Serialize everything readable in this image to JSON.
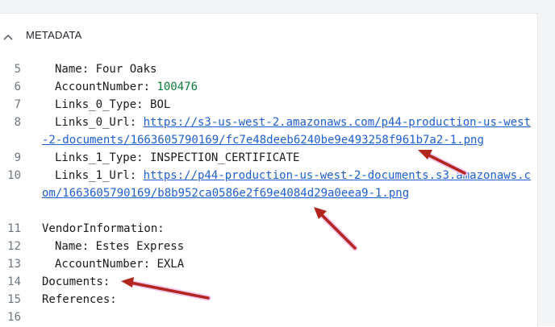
{
  "panel": {
    "title": "METADATA"
  },
  "lines": [
    {
      "n": "5",
      "key": "Name: ",
      "val": "Four Oaks"
    },
    {
      "n": "6",
      "key": "AccountNumber: ",
      "val": "100476"
    },
    {
      "n": "7",
      "key": "Links_0_Type: ",
      "val": "BOL"
    },
    {
      "n": "8",
      "key": "Links_0_Url: ",
      "link": "https://s3-us-west-2.amazonaws.com/p44-production-us-west-2-documents/1663605790169/fc7e48deeb6240be9e493258f961b7a2-1.png"
    },
    {
      "n": "9",
      "key": "Links_1_Type: ",
      "val": "INSPECTION_CERTIFICATE"
    },
    {
      "n": "10",
      "key": "Links_1_Url: ",
      "link": "https://p44-production-us-west-2-documents.s3.amazonaws.com/1663605790169/b8b952ca0586e2f69e4084d29a0eea9-1.png"
    },
    {
      "n": "11",
      "key": "VendorInformation:"
    },
    {
      "n": "12",
      "key": "Name: ",
      "val": "Estes Express"
    },
    {
      "n": "13",
      "key": "AccountNumber: ",
      "val": "EXLA"
    },
    {
      "n": "14",
      "key": "Documents:"
    },
    {
      "n": "15",
      "key": "References:"
    },
    {
      "n": "16",
      "key": ""
    }
  ],
  "colors": {
    "accent_arrow": "#b3261e",
    "link": "#1f5fd0",
    "number": "#0e7a3a",
    "highlight": "#f3c6f0"
  },
  "icons": {
    "collapse": "chevron-up-icon"
  }
}
